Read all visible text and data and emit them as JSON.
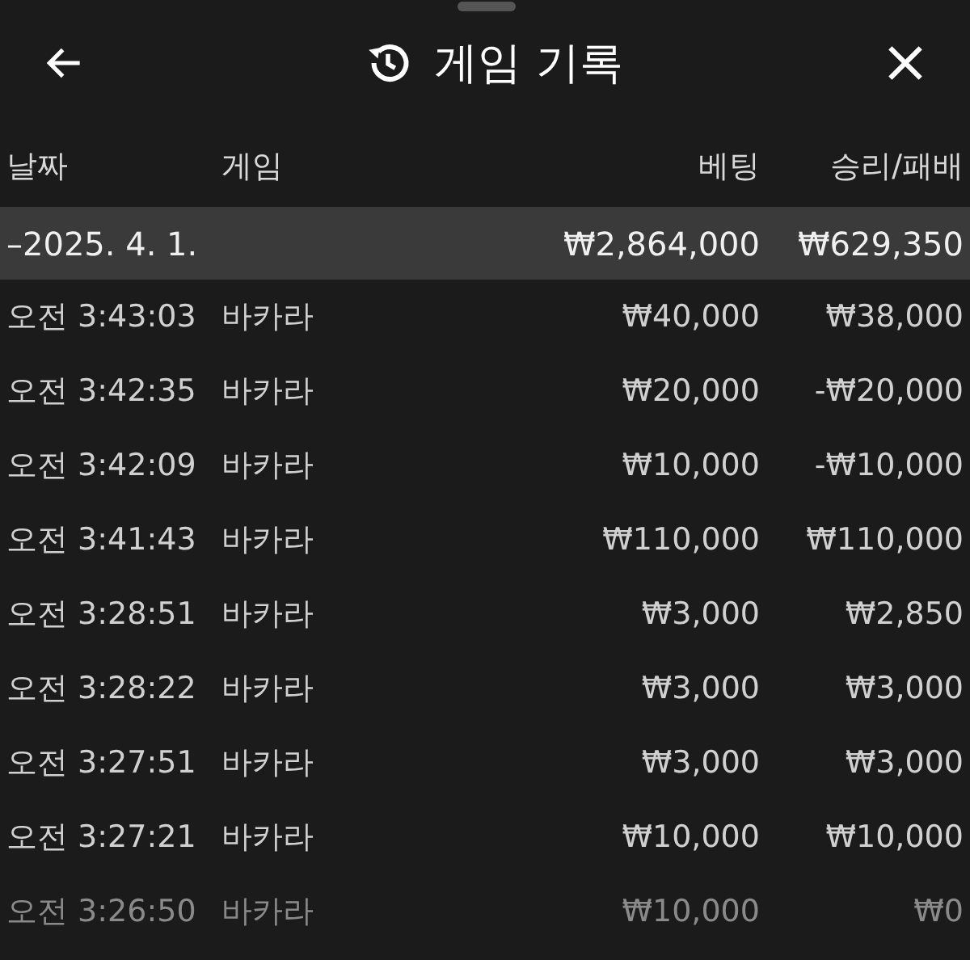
{
  "header": {
    "title": "게임 기록"
  },
  "columns": [
    "날짜",
    "게임",
    "베팅",
    "승리/패배"
  ],
  "group": {
    "toggle": "–",
    "date": "2025. 4. 1.",
    "bet": "₩2,864,000",
    "result": "₩629,350",
    "expanded": true
  },
  "rows": [
    {
      "time": "오전 3:43:03",
      "game": "바카라",
      "bet": "₩40,000",
      "result": "₩38,000",
      "faded": false
    },
    {
      "time": "오전 3:42:35",
      "game": "바카라",
      "bet": "₩20,000",
      "result": "-₩20,000",
      "faded": false
    },
    {
      "time": "오전 3:42:09",
      "game": "바카라",
      "bet": "₩10,000",
      "result": "-₩10,000",
      "faded": false
    },
    {
      "time": "오전 3:41:43",
      "game": "바카라",
      "bet": "₩110,000",
      "result": "₩110,000",
      "faded": false
    },
    {
      "time": "오전 3:28:51",
      "game": "바카라",
      "bet": "₩3,000",
      "result": "₩2,850",
      "faded": false
    },
    {
      "time": "오전 3:28:22",
      "game": "바카라",
      "bet": "₩3,000",
      "result": "₩3,000",
      "faded": false
    },
    {
      "time": "오전 3:27:51",
      "game": "바카라",
      "bet": "₩3,000",
      "result": "₩3,000",
      "faded": false
    },
    {
      "time": "오전 3:27:21",
      "game": "바카라",
      "bet": "₩10,000",
      "result": "₩10,000",
      "faded": false
    },
    {
      "time": "오전 3:26:50",
      "game": "바카라",
      "bet": "₩10,000",
      "result": "₩0",
      "faded": true
    }
  ]
}
